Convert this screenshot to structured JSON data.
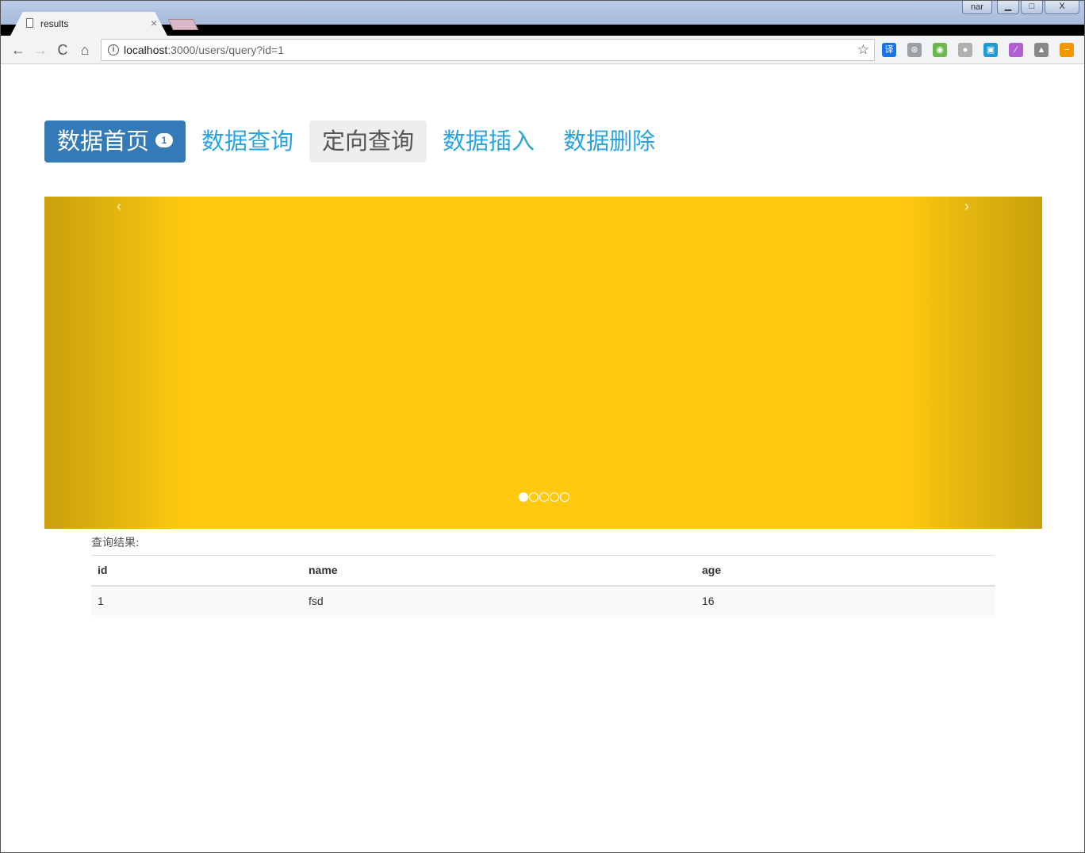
{
  "browser": {
    "tab_title": "results",
    "tab_close": "×",
    "user_badge": "nar",
    "window_buttons": {
      "minimize": "▁",
      "maximize": "□",
      "close": "X"
    },
    "nav": {
      "back": "←",
      "forward": "→",
      "reload": "C",
      "home": "⌂"
    },
    "url_host": "localhost",
    "url_rest": ":3000/users/query?id=1",
    "star": "☆",
    "extensions": [
      {
        "name": "translate-icon",
        "label": "译",
        "color": "#1a73e8"
      },
      {
        "name": "extension-icon-2",
        "label": "⊛",
        "color": "#9aa0a6"
      },
      {
        "name": "frog-icon",
        "label": "◉",
        "color": "#6bb84c"
      },
      {
        "name": "extension-icon-4",
        "label": "●",
        "color": "#b0b0b0"
      },
      {
        "name": "screenshot-icon",
        "label": "▣",
        "color": "#1e9bd7"
      },
      {
        "name": "pen-icon",
        "label": "⁄",
        "color": "#b060d0"
      },
      {
        "name": "warning-icon",
        "label": "▲",
        "color": "#888888"
      },
      {
        "name": "minus-icon",
        "label": "−",
        "color": "#f29900"
      }
    ]
  },
  "page": {
    "nav_items": [
      {
        "label": "数据首页",
        "badge": "1"
      },
      {
        "label": "数据查询"
      },
      {
        "label": "定向查询"
      },
      {
        "label": "数据插入"
      },
      {
        "label": "数据删除"
      }
    ],
    "carousel": {
      "prev": "‹",
      "next": "›",
      "indicator_count": 5,
      "active_index": 0,
      "color": "#fec90f"
    },
    "result_label": "查询结果:",
    "table": {
      "headers": [
        "id",
        "name",
        "age"
      ],
      "rows": [
        [
          "1",
          "fsd",
          "16"
        ]
      ]
    }
  }
}
